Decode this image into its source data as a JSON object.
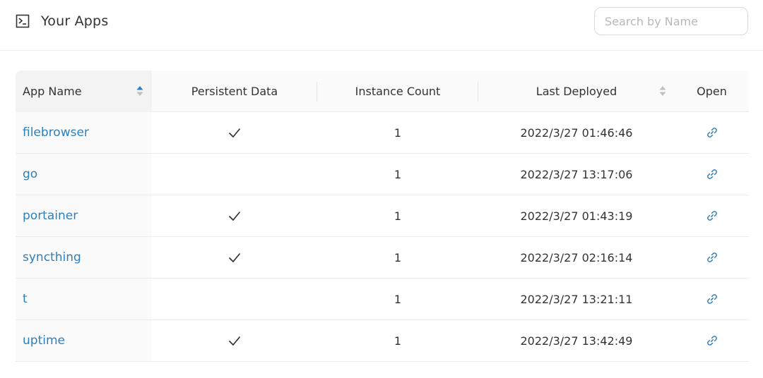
{
  "header": {
    "icon": "terminal-icon",
    "title": "Your Apps"
  },
  "search": {
    "placeholder": "Search by Name",
    "value": ""
  },
  "table": {
    "columns": {
      "app_name": "App Name",
      "persistent_data": "Persistent Data",
      "instance_count": "Instance Count",
      "last_deployed": "Last Deployed",
      "open": "Open"
    },
    "sort": {
      "column": "App Name",
      "direction": "ascending"
    },
    "rows": [
      {
        "name": "filebrowser",
        "persistent": true,
        "instances": "1",
        "deployed": "2022/3/27 01:46:46"
      },
      {
        "name": "go",
        "persistent": false,
        "instances": "1",
        "deployed": "2022/3/27 13:17:06"
      },
      {
        "name": "portainer",
        "persistent": true,
        "instances": "1",
        "deployed": "2022/3/27 01:43:19"
      },
      {
        "name": "syncthing",
        "persistent": true,
        "instances": "1",
        "deployed": "2022/3/27 02:16:14"
      },
      {
        "name": "t",
        "persistent": false,
        "instances": "1",
        "deployed": "2022/3/27 13:21:11"
      },
      {
        "name": "uptime",
        "persistent": true,
        "instances": "1",
        "deployed": "2022/3/27 13:42:49"
      }
    ]
  },
  "colors": {
    "link": "#2f7fbd",
    "sort_active": "#2f7fbd",
    "sort_inactive": "#bfbfbf"
  }
}
